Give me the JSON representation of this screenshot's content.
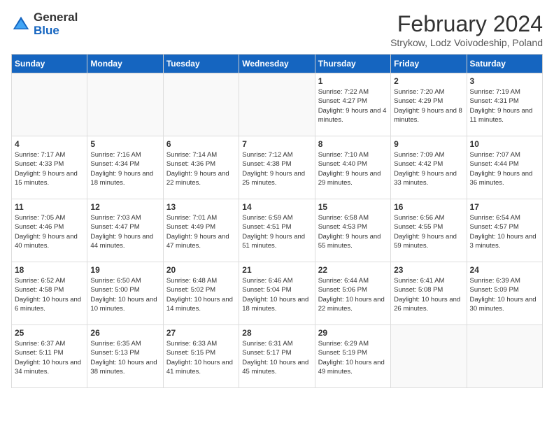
{
  "header": {
    "logo_general": "General",
    "logo_blue": "Blue",
    "month_year": "February 2024",
    "location": "Strykow, Lodz Voivodeship, Poland"
  },
  "weekdays": [
    "Sunday",
    "Monday",
    "Tuesday",
    "Wednesday",
    "Thursday",
    "Friday",
    "Saturday"
  ],
  "weeks": [
    [
      {
        "day": "",
        "info": ""
      },
      {
        "day": "",
        "info": ""
      },
      {
        "day": "",
        "info": ""
      },
      {
        "day": "",
        "info": ""
      },
      {
        "day": "1",
        "info": "Sunrise: 7:22 AM\nSunset: 4:27 PM\nDaylight: 9 hours\nand 4 minutes."
      },
      {
        "day": "2",
        "info": "Sunrise: 7:20 AM\nSunset: 4:29 PM\nDaylight: 9 hours\nand 8 minutes."
      },
      {
        "day": "3",
        "info": "Sunrise: 7:19 AM\nSunset: 4:31 PM\nDaylight: 9 hours\nand 11 minutes."
      }
    ],
    [
      {
        "day": "4",
        "info": "Sunrise: 7:17 AM\nSunset: 4:33 PM\nDaylight: 9 hours\nand 15 minutes."
      },
      {
        "day": "5",
        "info": "Sunrise: 7:16 AM\nSunset: 4:34 PM\nDaylight: 9 hours\nand 18 minutes."
      },
      {
        "day": "6",
        "info": "Sunrise: 7:14 AM\nSunset: 4:36 PM\nDaylight: 9 hours\nand 22 minutes."
      },
      {
        "day": "7",
        "info": "Sunrise: 7:12 AM\nSunset: 4:38 PM\nDaylight: 9 hours\nand 25 minutes."
      },
      {
        "day": "8",
        "info": "Sunrise: 7:10 AM\nSunset: 4:40 PM\nDaylight: 9 hours\nand 29 minutes."
      },
      {
        "day": "9",
        "info": "Sunrise: 7:09 AM\nSunset: 4:42 PM\nDaylight: 9 hours\nand 33 minutes."
      },
      {
        "day": "10",
        "info": "Sunrise: 7:07 AM\nSunset: 4:44 PM\nDaylight: 9 hours\nand 36 minutes."
      }
    ],
    [
      {
        "day": "11",
        "info": "Sunrise: 7:05 AM\nSunset: 4:46 PM\nDaylight: 9 hours\nand 40 minutes."
      },
      {
        "day": "12",
        "info": "Sunrise: 7:03 AM\nSunset: 4:47 PM\nDaylight: 9 hours\nand 44 minutes."
      },
      {
        "day": "13",
        "info": "Sunrise: 7:01 AM\nSunset: 4:49 PM\nDaylight: 9 hours\nand 47 minutes."
      },
      {
        "day": "14",
        "info": "Sunrise: 6:59 AM\nSunset: 4:51 PM\nDaylight: 9 hours\nand 51 minutes."
      },
      {
        "day": "15",
        "info": "Sunrise: 6:58 AM\nSunset: 4:53 PM\nDaylight: 9 hours\nand 55 minutes."
      },
      {
        "day": "16",
        "info": "Sunrise: 6:56 AM\nSunset: 4:55 PM\nDaylight: 9 hours\nand 59 minutes."
      },
      {
        "day": "17",
        "info": "Sunrise: 6:54 AM\nSunset: 4:57 PM\nDaylight: 10 hours\nand 3 minutes."
      }
    ],
    [
      {
        "day": "18",
        "info": "Sunrise: 6:52 AM\nSunset: 4:58 PM\nDaylight: 10 hours\nand 6 minutes."
      },
      {
        "day": "19",
        "info": "Sunrise: 6:50 AM\nSunset: 5:00 PM\nDaylight: 10 hours\nand 10 minutes."
      },
      {
        "day": "20",
        "info": "Sunrise: 6:48 AM\nSunset: 5:02 PM\nDaylight: 10 hours\nand 14 minutes."
      },
      {
        "day": "21",
        "info": "Sunrise: 6:46 AM\nSunset: 5:04 PM\nDaylight: 10 hours\nand 18 minutes."
      },
      {
        "day": "22",
        "info": "Sunrise: 6:44 AM\nSunset: 5:06 PM\nDaylight: 10 hours\nand 22 minutes."
      },
      {
        "day": "23",
        "info": "Sunrise: 6:41 AM\nSunset: 5:08 PM\nDaylight: 10 hours\nand 26 minutes."
      },
      {
        "day": "24",
        "info": "Sunrise: 6:39 AM\nSunset: 5:09 PM\nDaylight: 10 hours\nand 30 minutes."
      }
    ],
    [
      {
        "day": "25",
        "info": "Sunrise: 6:37 AM\nSunset: 5:11 PM\nDaylight: 10 hours\nand 34 minutes."
      },
      {
        "day": "26",
        "info": "Sunrise: 6:35 AM\nSunset: 5:13 PM\nDaylight: 10 hours\nand 38 minutes."
      },
      {
        "day": "27",
        "info": "Sunrise: 6:33 AM\nSunset: 5:15 PM\nDaylight: 10 hours\nand 41 minutes."
      },
      {
        "day": "28",
        "info": "Sunrise: 6:31 AM\nSunset: 5:17 PM\nDaylight: 10 hours\nand 45 minutes."
      },
      {
        "day": "29",
        "info": "Sunrise: 6:29 AM\nSunset: 5:19 PM\nDaylight: 10 hours\nand 49 minutes."
      },
      {
        "day": "",
        "info": ""
      },
      {
        "day": "",
        "info": ""
      }
    ]
  ]
}
